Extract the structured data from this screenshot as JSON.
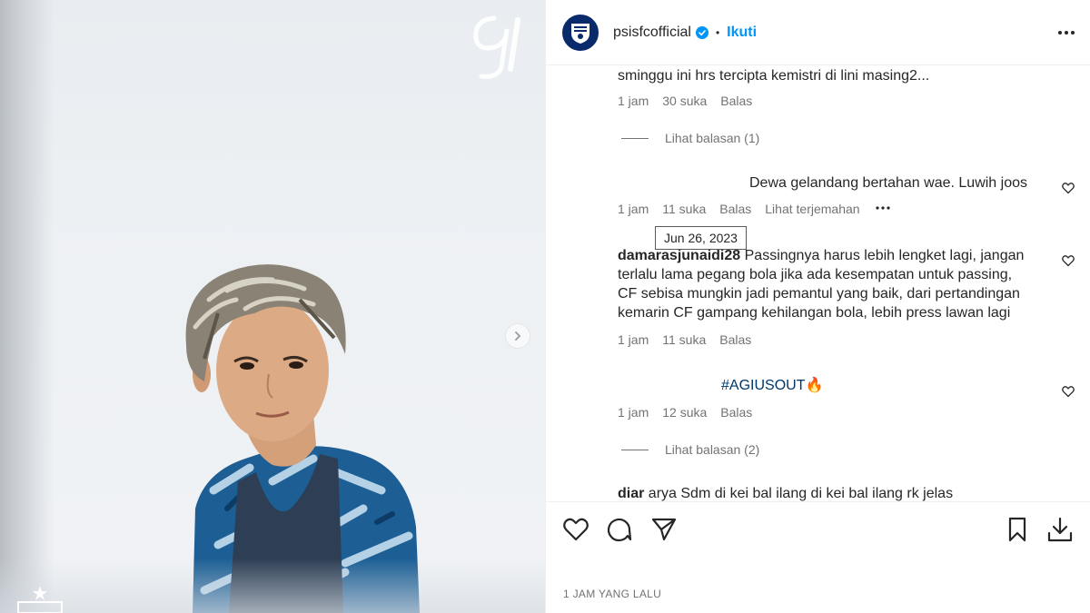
{
  "post": {
    "watermark_text": "91",
    "next_icon": "chevron-right-icon"
  },
  "header": {
    "username": "psisfcofficial",
    "separator": "•",
    "follow_label": "Ikuti",
    "avatar_icon": "club-crest-icon",
    "verified_icon": "verified-badge-icon",
    "more_icon": "more-horizontal-icon"
  },
  "comments": [
    {
      "username": "",
      "text": "sminggu ini hrs tercipta kemistri di lini masing2...",
      "time": "1 jam",
      "likes": "30 suka",
      "reply_label": "Balas",
      "view_replies": "Lihat balasan (1)"
    },
    {
      "username": "",
      "text": "Dewa gelandang bertahan wae. Luwih joos",
      "time": "1 jam",
      "likes": "11 suka",
      "reply_label": "Balas",
      "translate_label": "Lihat terjemahan",
      "tooltip": "Jun 26, 2023"
    },
    {
      "username": "damarasjunaidi28",
      "text_lines": [
        "Passingnya harus lebih lengket lagi, jangan",
        "terlalu lama pegang bola jika ada kesempatan untuk passing,",
        "CF sebisa mungkin jadi pemantul yang baik, dari pertandingan",
        "kemarin CF gampang kehilangan bola, lebih press lawan lagi"
      ],
      "time": "1 jam",
      "likes": "11 suka",
      "reply_label": "Balas"
    },
    {
      "username": "",
      "text": "#AGIUSOUT🔥",
      "time": "1 jam",
      "likes": "12 suka",
      "reply_label": "Balas",
      "view_replies": "Lihat balasan (2)"
    },
    {
      "username": "diar",
      "text": "arya Sdm di kei bal ilang di kei bal ilang rk jelas"
    }
  ],
  "actions": {
    "like_icon": "heart-icon",
    "comment_icon": "comment-icon",
    "share_icon": "send-icon",
    "save_icon": "bookmark-icon",
    "download_icon": "download-icon"
  },
  "footer": {
    "time_ago": "1 JAM YANG LALU"
  },
  "colors": {
    "link_blue": "#0095f6",
    "hashtag_blue": "#00376b",
    "muted_text": "#737373",
    "crest_navy": "#0a2a6b",
    "jersey_blue": "#1d5f95"
  }
}
